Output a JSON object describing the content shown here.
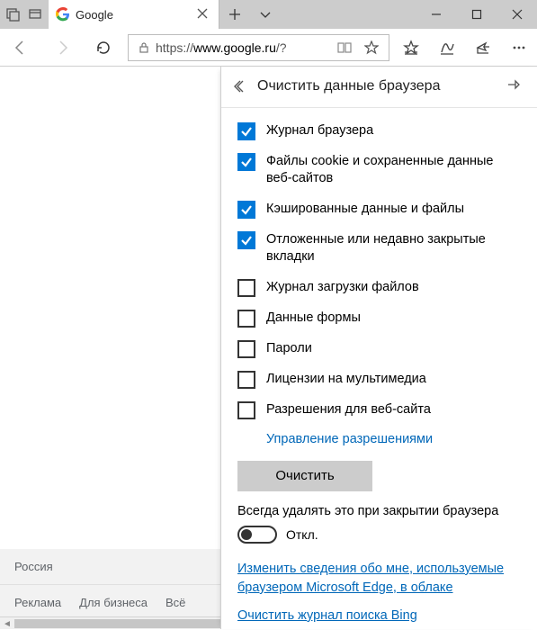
{
  "titlebar": {
    "tab_title": "Google"
  },
  "addressbar": {
    "scheme": "https://",
    "host": "www.google.ru",
    "path": "/?"
  },
  "panel": {
    "title": "Очистить данные браузера",
    "items": [
      {
        "label": "Журнал браузера",
        "checked": true
      },
      {
        "label": "Файлы cookie и сохраненные данные веб-сайтов",
        "checked": true
      },
      {
        "label": "Кэшированные данные и файлы",
        "checked": true
      },
      {
        "label": "Отложенные или недавно закрытые вкладки",
        "checked": true
      },
      {
        "label": "Журнал загрузки файлов",
        "checked": false
      },
      {
        "label": "Данные формы",
        "checked": false
      },
      {
        "label": "Пароли",
        "checked": false
      },
      {
        "label": "Лицензии на мультимедиа",
        "checked": false
      },
      {
        "label": "Разрешения для веб-сайта",
        "checked": false
      }
    ],
    "manage_permissions": "Управление разрешениями",
    "clear_button": "Очистить",
    "always_delete": "Всегда удалять это при закрытии браузера",
    "toggle_state": "Откл.",
    "cloud_link": "Изменить сведения обо мне, используемые браузером Microsoft Edge, в облаке",
    "bing_link": "Очистить журнал поиска Bing"
  },
  "footer": {
    "country": "Россия",
    "links": [
      "Реклама",
      "Для бизнеса",
      "Всё"
    ]
  }
}
